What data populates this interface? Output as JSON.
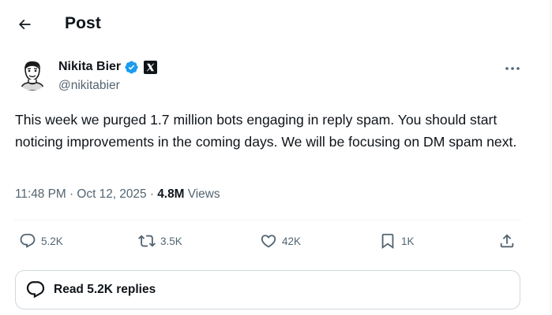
{
  "header": {
    "title": "Post",
    "back_icon": "arrow-left-icon"
  },
  "author": {
    "name": "Nikita Bier",
    "handle": "@nikitabier",
    "verified_icon": "verified-badge-icon",
    "verified_color": "#1d9bf0",
    "affiliation_icon": "x-logo-icon"
  },
  "post": {
    "text": "This week we purged 1.7 million bots engaging in reply spam. You should start noticing improvements in the coming days. We will be focusing on DM spam next.",
    "time": "11:48 PM",
    "date": "Oct 12, 2025",
    "views_count": "4.8M",
    "views_label": "Views"
  },
  "actions": {
    "replies": {
      "count": "5.2K",
      "icon": "reply-bubble-icon"
    },
    "reposts": {
      "count": "3.5K",
      "icon": "repost-icon"
    },
    "likes": {
      "count": "42K",
      "icon": "heart-icon"
    },
    "bookmarks": {
      "count": "1K",
      "icon": "bookmark-icon"
    },
    "share": {
      "icon": "share-icon"
    }
  },
  "read_replies": {
    "label": "Read 5.2K replies",
    "icon": "replies-bubble-icon"
  },
  "colors": {
    "text_primary": "#0f1419",
    "text_secondary": "#536471",
    "border": "#eff3f4"
  }
}
